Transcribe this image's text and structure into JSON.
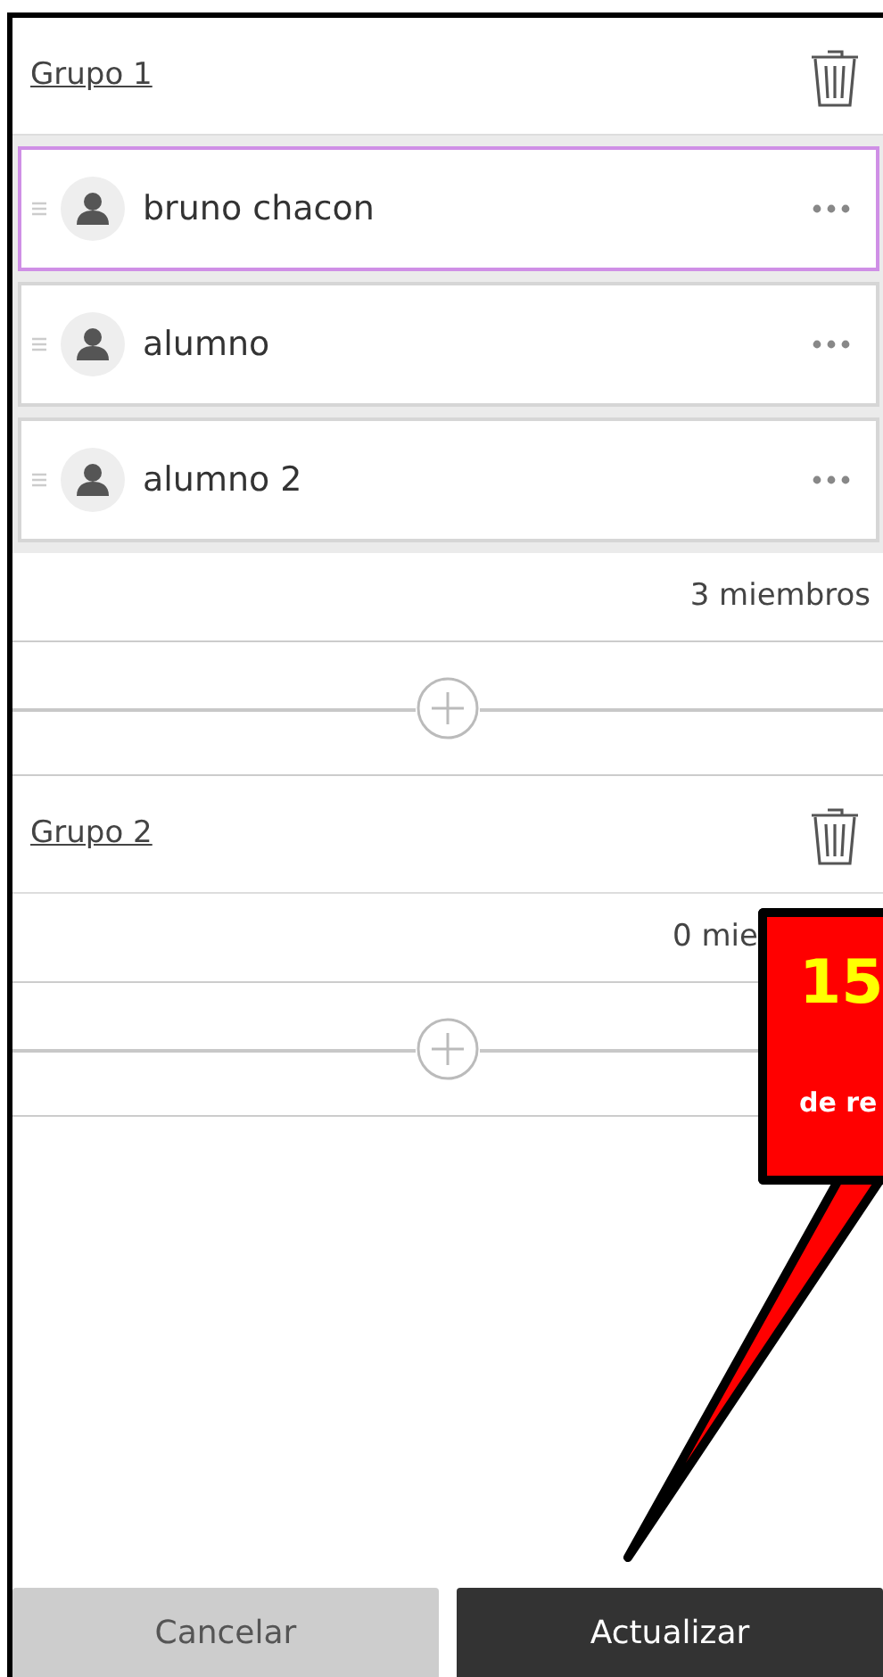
{
  "groups": [
    {
      "title": "Grupo 1",
      "members": [
        {
          "name": "bruno chacon",
          "selected": true
        },
        {
          "name": "alumno",
          "selected": false
        },
        {
          "name": "alumno 2",
          "selected": false
        }
      ],
      "count": "3 miembros"
    },
    {
      "title": "Grupo 2",
      "count": "0 mie",
      "callout": {
        "number": "15",
        "text": "de re"
      }
    }
  ],
  "buttons": [
    {
      "label": "Cancelar",
      "kind": "secondary"
    },
    {
      "label": "Actualizar",
      "kind": "primary"
    }
  ]
}
